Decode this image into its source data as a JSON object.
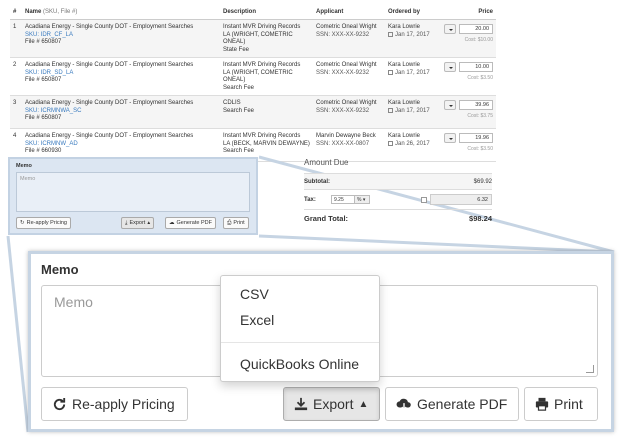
{
  "table": {
    "headers": {
      "num": "#",
      "name": "Name",
      "name_sub": "(SKU, File #)",
      "description": "Description",
      "applicant": "Applicant",
      "ordered_by": "Ordered by",
      "price": "Price"
    },
    "rows": [
      {
        "num": "1",
        "name": "Acadiana Energy - Single County DOT - Employment Searches",
        "sku": "SKU: IDR_CF_LA",
        "file": "File # 650807",
        "desc1": "Instant MVR Driving Records",
        "desc2": "LA (WRIGHT, COMETRIC ONEAL)",
        "desc3": "State Fee",
        "applicant": "Cometric Oneal Wright",
        "ssn": "SSN: XXX-XX-9232",
        "orderer": "Kara Lowrie",
        "date": "Jan 17, 2017",
        "price": "20.00",
        "cost": "Cost: $10.00"
      },
      {
        "num": "2",
        "name": "Acadiana Energy - Single County DOT - Employment Searches",
        "sku": "SKU: IDR_SD_LA",
        "file": "File # 650807",
        "desc1": "Instant MVR Driving Records",
        "desc2": "LA (WRIGHT, COMETRIC ONEAL)",
        "desc3": "Search Fee",
        "applicant": "Cometric Oneal Wright",
        "ssn": "SSN: XXX-XX-9232",
        "orderer": "Kara Lowrie",
        "date": "Jan 17, 2017",
        "price": "10.00",
        "cost": "Cost: $3.50"
      },
      {
        "num": "3",
        "name": "Acadiana Energy - Single County DOT - Employment Searches",
        "sku": "SKU: ICRMNWA_SC",
        "file": "File # 650807",
        "desc1": "CDLIS",
        "desc2": "Search Fee",
        "desc3": "",
        "applicant": "Cometric Oneal Wright",
        "ssn": "SSN: XXX-XX-9232",
        "orderer": "Kara Lowrie",
        "date": "Jan 17, 2017",
        "price": "39.96",
        "cost": "Cost: $3.75"
      },
      {
        "num": "4",
        "name": "Acadiana Energy - Single County DOT - Employment Searches",
        "sku": "SKU: ICRMNW_AD",
        "file": "File # 660930",
        "desc1": "Instant MVR Driving Records",
        "desc2": "LA (BECK, MARVIN DEWAYNE)",
        "desc3": "Search Fee",
        "applicant": "Marvin Dewayne Beck",
        "ssn": "SSN: XXX-XX-0807",
        "orderer": "Kara Lowrie",
        "date": "Jan 26, 2017",
        "price": "19.96",
        "cost": "Cost: $3.50"
      }
    ]
  },
  "memo_small": {
    "label": "Memo",
    "placeholder": "Memo",
    "reapply": "Re-apply Pricing",
    "export": "Export",
    "pdf": "Generate PDF",
    "print": "Print"
  },
  "amount": {
    "heading": "Amount Due",
    "subtotal_label": "Subtotal:",
    "subtotal": "$69.92",
    "tax_label": "Tax:",
    "tax_rate": "9.25",
    "tax_unit": "%",
    "tax_value": "6.32",
    "grand_label": "Grand Total:",
    "grand": "$98.24"
  },
  "zoom": {
    "label": "Memo",
    "placeholder": "Memo",
    "reapply": "Re-apply Pricing",
    "export": "Export",
    "pdf": "Generate PDF",
    "print": "Print",
    "dropdown": [
      "CSV",
      "Excel",
      "QuickBooks Online"
    ]
  },
  "colors": {
    "link": "#3a7bbf",
    "highlight": "#dce6f2",
    "frame": "#c6d4e3"
  }
}
